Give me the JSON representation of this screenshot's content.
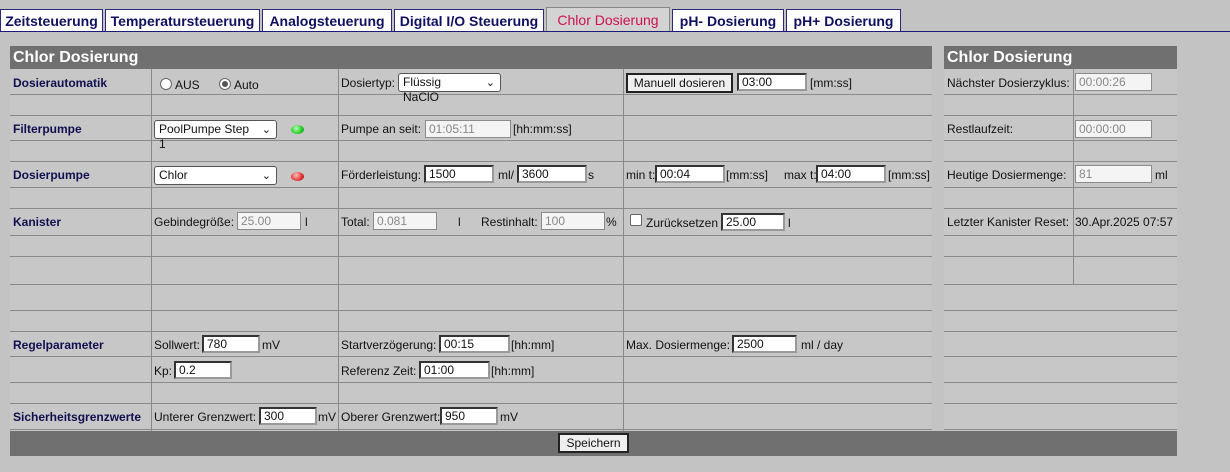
{
  "tabs": [
    {
      "label": "Zeitsteuerung"
    },
    {
      "label": "Temperatursteuerung"
    },
    {
      "label": "Analogsteuerung"
    },
    {
      "label": "Digital I/O Steuerung"
    },
    {
      "label": "Chlor Dosierung",
      "active": true
    },
    {
      "label": "pH- Dosierung"
    },
    {
      "label": "pH+ Dosierung"
    }
  ],
  "main": {
    "title": "Chlor Dosierung",
    "dosierautomatik": {
      "label": "Dosierautomatik",
      "radio_off": "AUS",
      "radio_auto": "Auto",
      "selected": "Auto",
      "dosiertyp_label": "Dosiertyp:",
      "dosiertyp_value": "Flüssig NaClO",
      "manual_button": "Manuell dosieren",
      "manual_value": "03:00",
      "manual_unit": "[mm:ss]"
    },
    "filterpumpe": {
      "label": "Filterpumpe",
      "select_value": "PoolPumpe Step 1",
      "status_color": "#22cc22",
      "pumpe_label": "Pumpe an seit:",
      "pumpe_value": "01:05:11",
      "pumpe_unit": "[hh:mm:ss]"
    },
    "dosierpumpe": {
      "label": "Dosierpumpe",
      "select_value": "Chlor",
      "status_color": "#e03030",
      "foerder_label": "Förderleistung:",
      "foerder_value": "1500",
      "foerder_unit": "ml/",
      "time_value": "3600",
      "time_unit": "s",
      "min_label": "min t:",
      "min_value": "00:04",
      "min_unit": "[mm:ss]",
      "max_label": "max t:",
      "max_value": "04:00",
      "max_unit": "[mm:ss]"
    },
    "kanister": {
      "label": "Kanister",
      "gebinde_label": "Gebindegröße:",
      "gebinde_value": "25.00",
      "gebinde_unit": "l",
      "total_label": "Total:",
      "total_value": "0.081",
      "total_unit": "l",
      "rest_label": "Restinhalt:",
      "rest_value": "100",
      "rest_unit": "%",
      "reset_label": "Zurücksetzen",
      "reset_value": "25.00",
      "reset_unit": "l"
    },
    "regelparameter": {
      "label": "Regelparameter",
      "sollwert_label": "Sollwert:",
      "sollwert_value": "780",
      "sollwert_unit": "mV",
      "start_label": "Startverzögerung:",
      "start_value": "00:15",
      "start_unit": "[hh:mm]",
      "maxdos_label": "Max. Dosiermenge:",
      "maxdos_value": "2500",
      "maxdos_unit": "ml / day",
      "kp_label": "Kp:",
      "kp_value": "0.2",
      "ref_label": "Referenz Zeit:",
      "ref_value": "01:00",
      "ref_unit": "[hh:mm]"
    },
    "sicherheit": {
      "label": "Sicherheitsgrenzwerte",
      "unterer_label": "Unterer Grenzwert:",
      "unterer_value": "300",
      "unterer_unit": "mV",
      "oberer_label": "Oberer Grenzwert:",
      "oberer_value": "950",
      "oberer_unit": "mV"
    },
    "save_button": "Speichern"
  },
  "side": {
    "title": "Chlor Dosierung",
    "naechster_label": "Nächster Dosierzyklus:",
    "naechster_value": "00:00:26",
    "restlauf_label": "Restlaufzeit:",
    "restlauf_value": "00:00:00",
    "heutige_label": "Heutige Dosiermenge:",
    "heutige_value": "81",
    "heutige_unit": "ml",
    "reset_label": "Letzter Kanister Reset:",
    "reset_value": "30.Apr.2025 07:57"
  }
}
